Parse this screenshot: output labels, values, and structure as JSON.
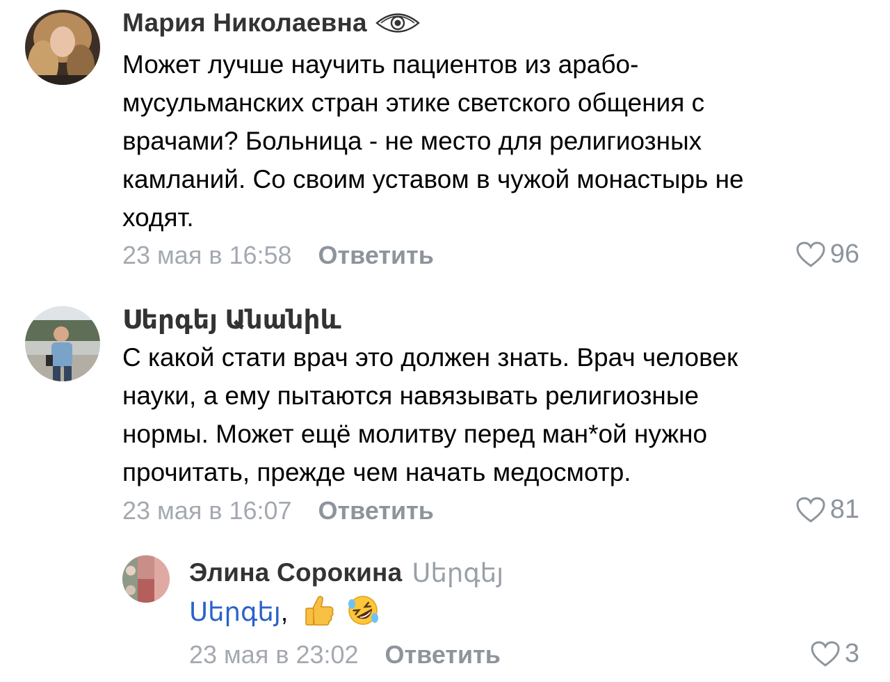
{
  "comments": [
    {
      "author": "Мария Николаевна",
      "author_badge_icon": "eye-icon",
      "text": "Может лучше научить пациентов из арабо-\nмусульманских стран этике светского общения с\nврачами?  Больница - не место для религиозных\nкамланий. Со своим уставом в чужой монастырь не\nходят.",
      "date": "23 мая в 16:58",
      "reply_label": "Ответить",
      "likes": "96"
    },
    {
      "author": "Սերգեյ Անանիև",
      "text": "С какой стати врач это должен знать. Врач человек\nнауки, а ему пытаются навязывать религиозные\nнормы. Может ещё молитву перед ман*ой нужно\nпрочитать, прежде чем начать медосмотр.",
      "date": "23 мая в 16:07",
      "reply_label": "Ответить",
      "likes": "81"
    },
    {
      "author": "Элина Сорокина",
      "reply_to": "Սերգեյ",
      "mention": "Սերգեյ",
      "mention_suffix": ",",
      "emojis": [
        "thumbs-up-emoji",
        "rolling-on-floor-laughing-emoji"
      ],
      "date": "23 мая в 23:02",
      "reply_label": "Ответить",
      "likes": "3"
    }
  ],
  "colors": {
    "author": "#333333",
    "meta": "#a4a9b0",
    "reply": "#8d949c",
    "mention": "#2a62c9"
  }
}
